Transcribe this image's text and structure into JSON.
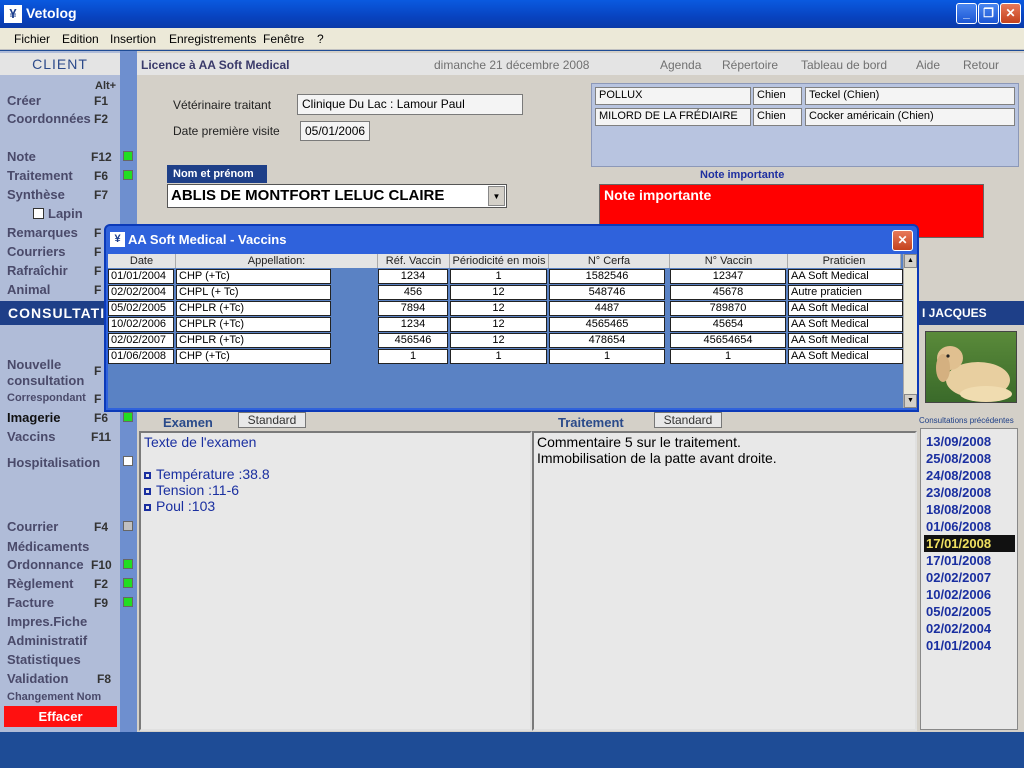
{
  "window": {
    "title": "Vetolog",
    "min": "_",
    "max": "❐",
    "close": "✕"
  },
  "menu": [
    "Fichier",
    "Edition",
    "Insertion",
    "Enregistrements",
    "Fenêtre",
    "?"
  ],
  "topbar": {
    "client_label": "CLIENT",
    "licence": "Licence à  AA Soft Medical",
    "date": "dimanche 21 décembre 2008",
    "nav": [
      "Agenda",
      "Répertoire",
      "Tableau de bord",
      "Aide",
      "Retour"
    ]
  },
  "sidebar": {
    "alt_label": "Alt+",
    "client_items": [
      {
        "label": "Créer",
        "key": "F1"
      },
      {
        "label": "Coordonnées",
        "key": "F2"
      },
      {
        "label": "Note",
        "key": "F12"
      },
      {
        "label": "Traitement",
        "key": "F6"
      },
      {
        "label": "Synthèse",
        "key": "F7"
      },
      {
        "label": "Lapin",
        "key": ""
      },
      {
        "label": "Remarques",
        "key": "F"
      },
      {
        "label": "Courriers",
        "key": "F"
      },
      {
        "label": "Rafraîchir",
        "key": "F"
      },
      {
        "label": "Animal",
        "key": "F"
      }
    ],
    "consult_label": "CONSULTATI",
    "consult_items": [
      {
        "label": "Nouvelle",
        "key": ""
      },
      {
        "label": "consultation",
        "key": "F"
      },
      {
        "label": "Correspondant",
        "key": "F"
      },
      {
        "label": "Imagerie",
        "key": "F6"
      },
      {
        "label": "Vaccins",
        "key": "F11"
      },
      {
        "label": "Hospitalisation",
        "key": ""
      },
      {
        "label": "Courrier",
        "key": "F4"
      },
      {
        "label": "Médicaments",
        "key": ""
      },
      {
        "label": "Ordonnance",
        "key": "F10"
      },
      {
        "label": "Règlement",
        "key": "F2"
      },
      {
        "label": "Facture",
        "key": "F9"
      },
      {
        "label": "Impres.Fiche",
        "key": ""
      },
      {
        "label": "Administratif",
        "key": ""
      },
      {
        "label": "Statistiques",
        "key": ""
      },
      {
        "label": "Validation",
        "key": "F8"
      },
      {
        "label": "Changement Nom",
        "key": ""
      }
    ],
    "effacer": "Effacer"
  },
  "client": {
    "vet_label": "Vétérinaire traitant",
    "vet_value": "Clinique Du Lac : Lamour Paul",
    "first_visit_label": "Date première visite",
    "first_visit_value": "05/01/2006",
    "name_label": "Nom et prénom",
    "name_value": "ABLIS DE MONTFORT LELUC CLAIRE"
  },
  "animals": [
    {
      "name": "POLLUX",
      "species": "Chien",
      "breed": "Teckel (Chien)"
    },
    {
      "name": "MILORD DE LA FRÉDIAIRE",
      "species": "Chien",
      "breed": "Cocker américain (Chien)"
    }
  ],
  "note": {
    "header": "Note importante",
    "value": "Note importante"
  },
  "right_panel": {
    "header": "I JACQUES",
    "consultations_label": "Consultations précédentes",
    "dates": [
      "13/09/2008",
      "25/08/2008",
      "24/08/2008",
      "23/08/2008",
      "18/08/2008",
      "01/06/2008",
      "17/01/2008",
      "17/01/2008",
      "02/02/2007",
      "10/02/2006",
      "05/02/2005",
      "02/02/2004",
      "01/01/2004"
    ],
    "selected_index": 6
  },
  "examen": {
    "title": "Examen",
    "std_button": "Standard",
    "text": "Texte de l'examen",
    "items": [
      "Température :38.8",
      "Tension :11-6",
      "Poul :103"
    ]
  },
  "traitement": {
    "title": "Traitement",
    "std_button": "Standard",
    "lines": [
      "Commentaire 5 sur le traitement.",
      "Immobilisation de la patte avant droite."
    ]
  },
  "dialog": {
    "title": "AA Soft Medical - Vaccins",
    "columns": [
      "Date",
      "Appellation:",
      "Réf. Vaccin",
      "Périodicité en mois",
      "N° Cerfa",
      "N° Vaccin",
      "Praticien"
    ],
    "rows": [
      [
        "01/01/2004",
        "CHP (+Tc)",
        "1234",
        "1",
        "1582546",
        "12347",
        "AA Soft Medical"
      ],
      [
        "02/02/2004",
        "CHPL (+ Tc)",
        "456",
        "12",
        "548746",
        "45678",
        "Autre praticien"
      ],
      [
        "05/02/2005",
        "CHPLR (+Tc)",
        "7894",
        "12",
        "4487",
        "789870",
        "AA Soft Medical"
      ],
      [
        "10/02/2006",
        "CHPLR (+Tc)",
        "1234",
        "12",
        "4565465",
        "45654",
        "AA Soft Medical"
      ],
      [
        "02/02/2007",
        "CHPLR (+Tc)",
        "456546",
        "12",
        "478654",
        "45654654",
        "AA Soft Medical"
      ],
      [
        "01/06/2008",
        "CHP (+Tc)",
        "1",
        "1",
        "1",
        "1",
        "AA Soft Medical"
      ]
    ]
  }
}
